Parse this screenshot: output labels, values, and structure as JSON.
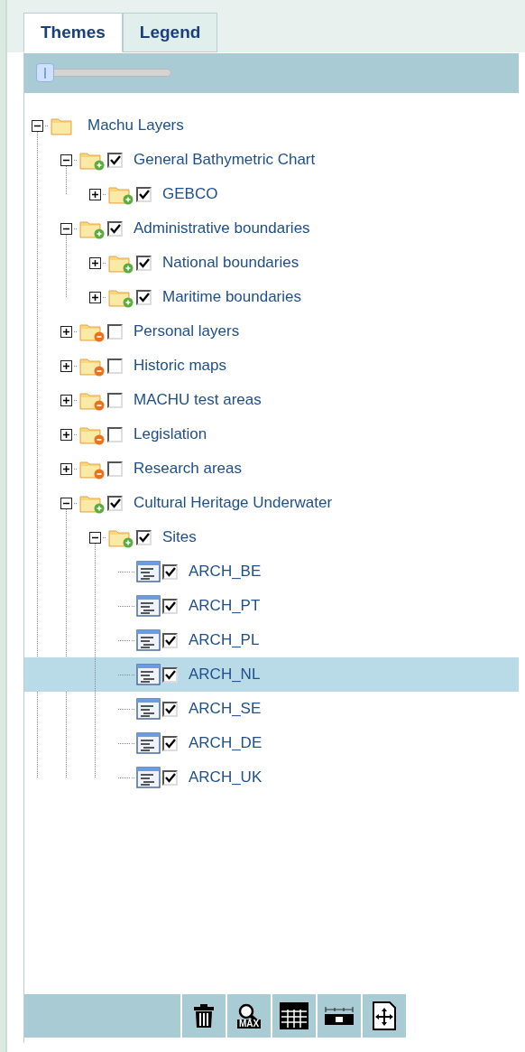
{
  "tabs": [
    {
      "label": "Themes",
      "selected": true
    },
    {
      "label": "Legend",
      "selected": false
    }
  ],
  "tree": [
    {
      "kind": "root",
      "label": "Machu Layers",
      "expanded": true,
      "selected": false,
      "children": [
        {
          "kind": "folder",
          "label": "General Bathymetric Chart",
          "expanded": true,
          "checked": true,
          "selected": false,
          "children": [
            {
              "kind": "folder",
              "label": "GEBCO",
              "expanded": false,
              "checked": true,
              "selected": false
            }
          ]
        },
        {
          "kind": "folder",
          "label": "Administrative boundaries",
          "expanded": true,
          "checked": true,
          "selected": false,
          "children": [
            {
              "kind": "folder",
              "label": "National boundaries",
              "expanded": false,
              "checked": true,
              "selected": false
            },
            {
              "kind": "folder",
              "label": "Maritime boundaries",
              "expanded": false,
              "checked": true,
              "selected": false
            }
          ]
        },
        {
          "kind": "folder",
          "label": "Personal layers",
          "expanded": false,
          "checked": false,
          "selected": false
        },
        {
          "kind": "folder",
          "label": "Historic maps",
          "expanded": false,
          "checked": false,
          "selected": false
        },
        {
          "kind": "folder",
          "label": "MACHU test areas",
          "expanded": false,
          "checked": false,
          "selected": false
        },
        {
          "kind": "folder",
          "label": "Legislation",
          "expanded": false,
          "checked": false,
          "selected": false
        },
        {
          "kind": "folder",
          "label": "Research areas",
          "expanded": false,
          "checked": false,
          "selected": false
        },
        {
          "kind": "folder",
          "label": "Cultural Heritage Underwater",
          "expanded": true,
          "checked": true,
          "selected": false,
          "children": [
            {
              "kind": "folder",
              "label": "Sites",
              "expanded": true,
              "checked": true,
              "selected": false,
              "children": [
                {
                  "kind": "layer",
                  "label": "ARCH_BE",
                  "checked": true,
                  "selected": false
                },
                {
                  "kind": "layer",
                  "label": "ARCH_PT",
                  "checked": true,
                  "selected": false
                },
                {
                  "kind": "layer",
                  "label": "ARCH_PL",
                  "checked": true,
                  "selected": false
                },
                {
                  "kind": "layer",
                  "label": "ARCH_NL",
                  "checked": true,
                  "selected": true
                },
                {
                  "kind": "layer",
                  "label": "ARCH_SE",
                  "checked": true,
                  "selected": false
                },
                {
                  "kind": "layer",
                  "label": "ARCH_DE",
                  "checked": true,
                  "selected": false
                },
                {
                  "kind": "layer",
                  "label": "ARCH_UK",
                  "checked": true,
                  "selected": false
                }
              ]
            }
          ]
        }
      ]
    }
  ],
  "toolbar": {
    "zoom_label": "MAX"
  }
}
